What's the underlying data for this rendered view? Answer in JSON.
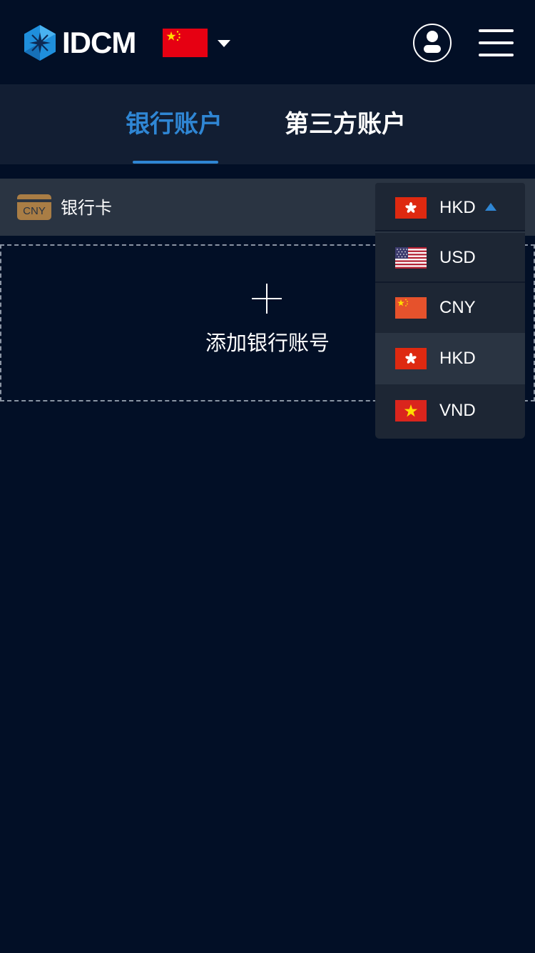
{
  "header": {
    "logo_text": "IDCM",
    "region_flag": "china-flag-icon",
    "menu_icon": "hamburger-menu-icon",
    "user_icon": "user-avatar-icon"
  },
  "tabs": [
    {
      "label": "银行账户",
      "active": true
    },
    {
      "label": "第三方账户",
      "active": false
    }
  ],
  "card": {
    "code": "CNY",
    "label": "银行卡"
  },
  "add_account": {
    "label": "添加银行账号"
  },
  "currency": {
    "selected": "HKD",
    "options": [
      {
        "code": "USD",
        "flag": "usa-flag-icon"
      },
      {
        "code": "CNY",
        "flag": "china-flag-icon"
      },
      {
        "code": "HKD",
        "flag": "hong-kong-flag-icon",
        "highlighted": true
      },
      {
        "code": "VND",
        "flag": "vietnam-flag-icon"
      }
    ]
  },
  "colors": {
    "background": "#020f26",
    "accent": "#2f86d4",
    "card_bar": "#2a3442",
    "dropdown": "#1d2634"
  }
}
